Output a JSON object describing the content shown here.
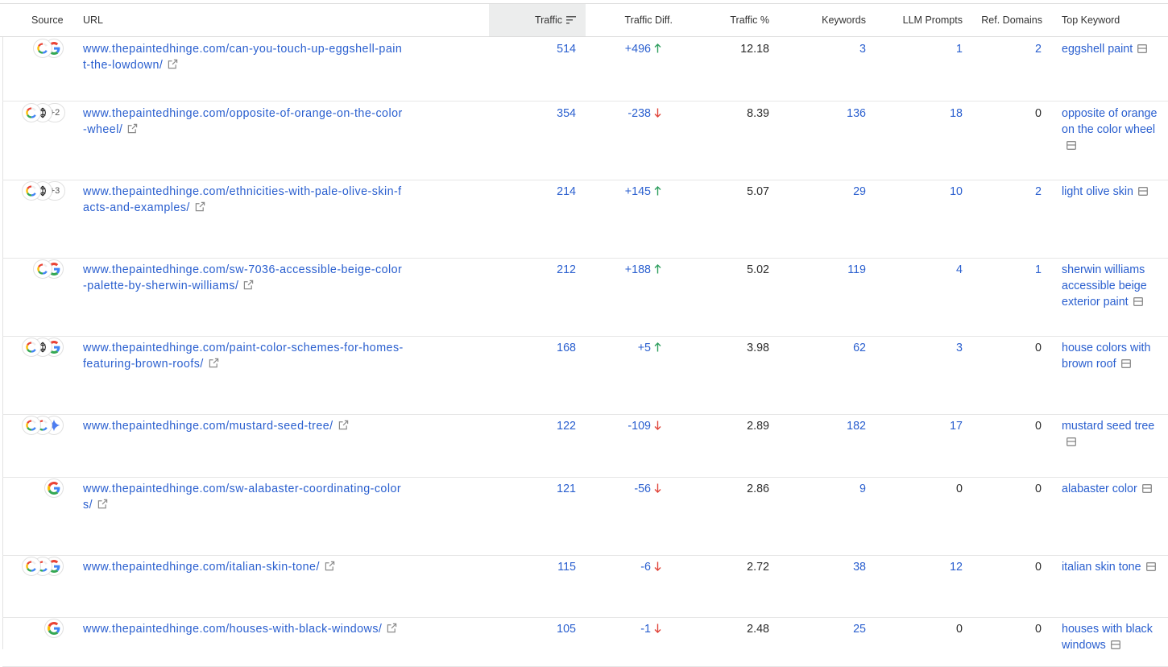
{
  "header": {
    "source": "Source",
    "url": "URL",
    "traffic": "Traffic",
    "traffic_diff": "Traffic Diff.",
    "traffic_pct": "Traffic %",
    "keywords": "Keywords",
    "llm_prompts": "LLM Prompts",
    "ref_domains": "Ref. Domains",
    "top_keyword": "Top Keyword"
  },
  "rows": [
    {
      "sources": [
        "chatgpt",
        "google"
      ],
      "more": "",
      "url": "www.thepaintedhinge.com/can-you-touch-up-eggshell-paint-the-lowdown/",
      "traffic": "514",
      "diff": "+496",
      "dir": "up",
      "pct": "12.18",
      "keywords": "3",
      "llm": "1",
      "llm_link": true,
      "ref": "2",
      "ref_link": true,
      "top": "eggshell paint"
    },
    {
      "sources": [
        "chatgpt",
        "perplexity"
      ],
      "more": "+2",
      "url": "www.thepaintedhinge.com/opposite-of-orange-on-the-color-wheel/",
      "traffic": "354",
      "diff": "-238",
      "dir": "down",
      "pct": "8.39",
      "keywords": "136",
      "llm": "18",
      "llm_link": true,
      "ref": "0",
      "ref_link": false,
      "top": "opposite of orange on the color wheel"
    },
    {
      "sources": [
        "chatgpt",
        "perplexity"
      ],
      "more": "+3",
      "url": "www.thepaintedhinge.com/ethnicities-with-pale-olive-skin-facts-and-examples/",
      "traffic": "214",
      "diff": "+145",
      "dir": "up",
      "pct": "5.07",
      "keywords": "29",
      "llm": "10",
      "llm_link": true,
      "ref": "2",
      "ref_link": true,
      "top": "light olive skin"
    },
    {
      "sources": [
        "chatgpt",
        "google"
      ],
      "more": "",
      "url": "www.thepaintedhinge.com/sw-7036-accessible-beige-color-palette-by-sherwin-williams/",
      "traffic": "212",
      "diff": "+188",
      "dir": "up",
      "pct": "5.02",
      "keywords": "119",
      "llm": "4",
      "llm_link": true,
      "ref": "1",
      "ref_link": true,
      "top": "sherwin williams accessible beige exterior paint"
    },
    {
      "sources": [
        "chatgpt",
        "perplexity",
        "google"
      ],
      "more": "",
      "url": "www.thepaintedhinge.com/paint-color-schemes-for-homes-featuring-brown-roofs/",
      "traffic": "168",
      "diff": "+5",
      "dir": "up",
      "pct": "3.98",
      "keywords": "62",
      "llm": "3",
      "llm_link": true,
      "ref": "0",
      "ref_link": false,
      "top": "house colors with brown roof"
    },
    {
      "sources": [
        "chatgpt",
        "chatgpt",
        "gemini"
      ],
      "more": "",
      "url": "www.thepaintedhinge.com/mustard-seed-tree/",
      "traffic": "122",
      "diff": "-109",
      "dir": "down",
      "pct": "2.89",
      "keywords": "182",
      "llm": "17",
      "llm_link": true,
      "ref": "0",
      "ref_link": false,
      "top": "mustard seed tree"
    },
    {
      "sources": [
        "google"
      ],
      "more": "",
      "url": "www.thepaintedhinge.com/sw-alabaster-coordinating-colors/",
      "traffic": "121",
      "diff": "-56",
      "dir": "down",
      "pct": "2.86",
      "keywords": "9",
      "llm": "0",
      "llm_link": false,
      "ref": "0",
      "ref_link": false,
      "top": "alabaster color"
    },
    {
      "sources": [
        "chatgpt",
        "chatgpt",
        "google"
      ],
      "more": "",
      "url": "www.thepaintedhinge.com/italian-skin-tone/",
      "traffic": "115",
      "diff": "-6",
      "dir": "down",
      "pct": "2.72",
      "keywords": "38",
      "llm": "12",
      "llm_link": true,
      "ref": "0",
      "ref_link": false,
      "top": "italian skin tone"
    },
    {
      "sources": [
        "google"
      ],
      "more": "",
      "url": "www.thepaintedhinge.com/houses-with-black-windows/",
      "traffic": "105",
      "diff": "-1",
      "dir": "down",
      "pct": "2.48",
      "keywords": "25",
      "llm": "0",
      "llm_link": false,
      "ref": "0",
      "ref_link": false,
      "top": "houses with black windows"
    }
  ],
  "colors": {
    "link": "#2a5fcf",
    "up": "#2e9e5e",
    "down": "#e0453a",
    "google_blue": "#4285F4",
    "google_red": "#EA4335",
    "google_yellow": "#FBBC05",
    "google_green": "#34A853",
    "gemini": "#4c7cf0"
  },
  "icons": {
    "chatgpt": "chatgpt-icon",
    "perplexity": "perplexity-icon",
    "google": "google-icon",
    "gemini": "gemini-icon",
    "external": "external-link-icon",
    "keyword": "serp-features-icon",
    "sort": "sort-descending-icon"
  }
}
